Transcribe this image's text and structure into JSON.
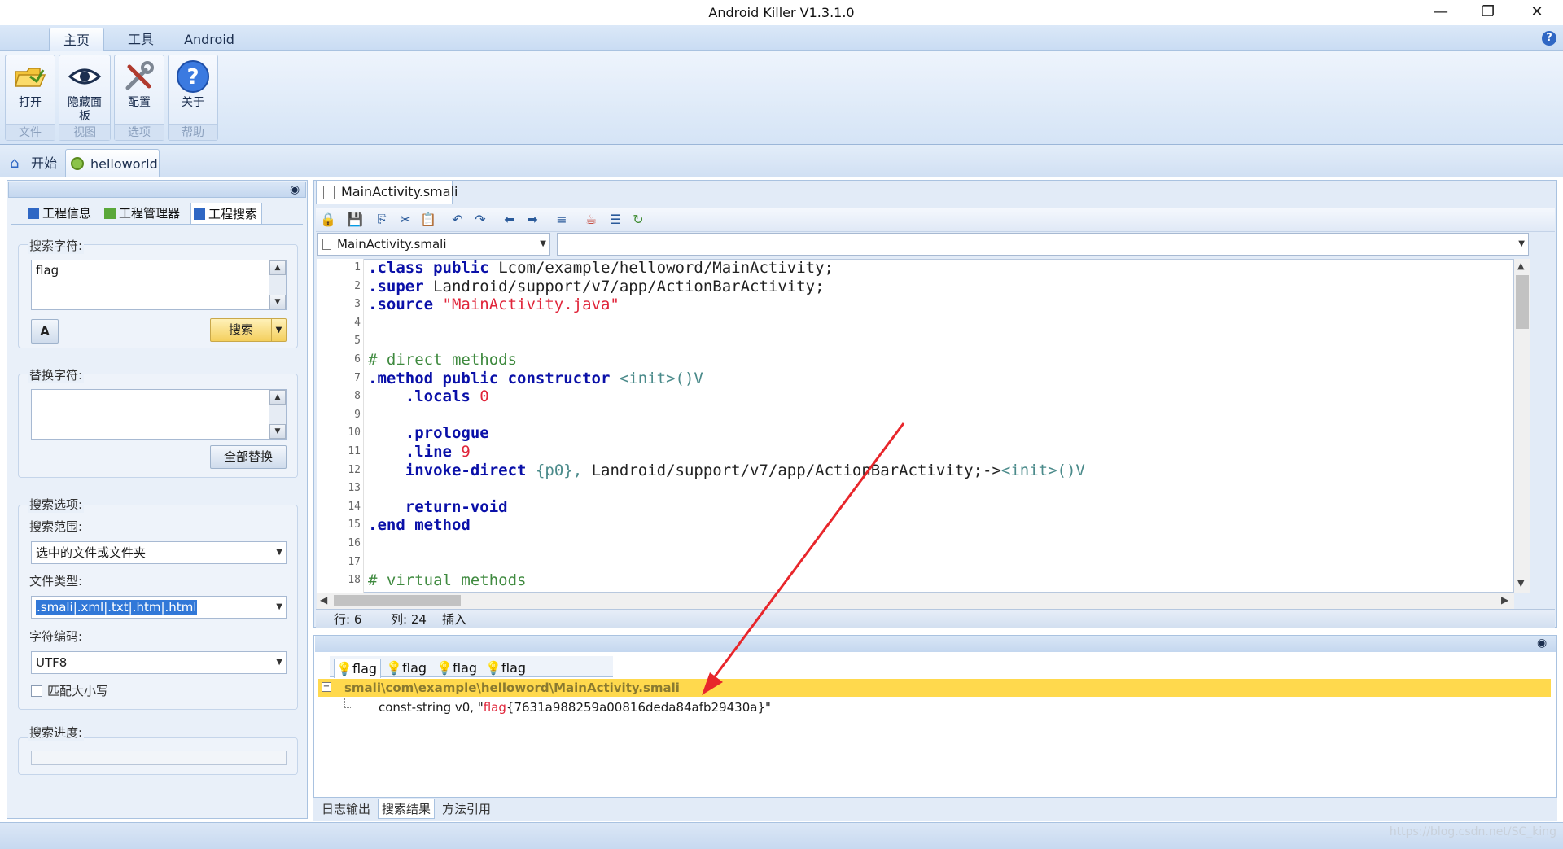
{
  "window": {
    "title": "Android Killer V1.3.1.0"
  },
  "ribbon": {
    "tabs": [
      "主页",
      "工具",
      "Android"
    ],
    "groups": [
      {
        "buttons": [
          "打开"
        ],
        "label": "文件",
        "icon": "folder-open-icon"
      },
      {
        "buttons": [
          "隐藏面板"
        ],
        "label": "视图",
        "icon": "eye-icon"
      },
      {
        "buttons": [
          "配置"
        ],
        "label": "选项",
        "icon": "tools-icon"
      },
      {
        "buttons": [
          "关于"
        ],
        "label": "帮助",
        "icon": "help-icon"
      }
    ]
  },
  "doc_tabs": {
    "start": "开始",
    "project": "helloworld"
  },
  "left_panel": {
    "tabs": [
      "工程信息",
      "工程管理器",
      "工程搜索"
    ],
    "search": {
      "label": "搜索字符:",
      "value": "flag",
      "search_button": "搜索"
    },
    "replace": {
      "label": "替换字符:",
      "value": "",
      "replace_all_button": "全部替换"
    },
    "options": {
      "label": "搜索选项:",
      "scope_label": "搜索范围:",
      "scope_value": "选中的文件或文件夹",
      "filetype_label": "文件类型:",
      "filetype_value": ".smali|.xml|.txt|.htm|.html",
      "encoding_label": "字符编码:",
      "encoding_value": "UTF8",
      "match_case_label": "匹配大小写"
    },
    "progress": {
      "label": "搜索进度:",
      "fraction": 0
    }
  },
  "editor": {
    "file_tab": "MainActivity.smali",
    "file_combo": "MainActivity.smali",
    "lines": [
      {
        "n": "1"
      },
      {
        "n": "2"
      },
      {
        "n": "3"
      },
      {
        "n": "4"
      },
      {
        "n": "5"
      },
      {
        "n": "6"
      },
      {
        "n": "7"
      },
      {
        "n": "8"
      },
      {
        "n": "9"
      },
      {
        "n": "10"
      },
      {
        "n": "11"
      },
      {
        "n": "12"
      },
      {
        "n": "13"
      },
      {
        "n": "14"
      },
      {
        "n": "15"
      },
      {
        "n": "16"
      },
      {
        "n": "17"
      },
      {
        "n": "18"
      }
    ],
    "code": {
      "l1_kw1": ".class",
      "l1_kw2": "public",
      "l1_rest": "Lcom/example/helloword/MainActivity;",
      "l2_kw": ".super",
      "l2_rest": "Landroid/support/v7/app/ActionBarActivity;",
      "l3_kw": ".source",
      "l3_str": "\"MainActivity.java\"",
      "l6_cm": "# direct methods",
      "l7_kw": ".method public constructor",
      "l7_rest": "<init>()V",
      "l8_kw": ".locals",
      "l8_num": "0",
      "l10_kw": ".prologue",
      "l11_kw": ".line",
      "l11_num": "9",
      "l12_kw": "invoke-direct",
      "l12_reg": "{p0},",
      "l12_rest": "Landroid/support/v7/app/ActionBarActivity;->",
      "l12_init": "<init>()V",
      "l14_kw": "return-void",
      "l15_kw": ".end method",
      "l18_cm": "# virtual methods"
    },
    "status": {
      "row": "行: 6",
      "col": "列: 24",
      "mode": "插入"
    }
  },
  "results": {
    "tabs": [
      "flag",
      "flag",
      "flag",
      "flag"
    ],
    "file_path": "smali\\com\\example\\helloword\\MainActivity.smali",
    "match_prefix": "const-string v0, \"",
    "match_hit": "flag",
    "match_suffix": "{7631a988259a00816deda84afb29430a}\""
  },
  "bottom_tabs": [
    "日志输出",
    "搜索结果",
    "方法引用"
  ],
  "watermark": "https://blog.csdn.net/SC_king",
  "colors": {
    "accent": "#ffd94d",
    "arrow": "#e8262b",
    "keyword": "#0a10a8",
    "string": "#e0253a",
    "comment": "#3f8a3f"
  }
}
